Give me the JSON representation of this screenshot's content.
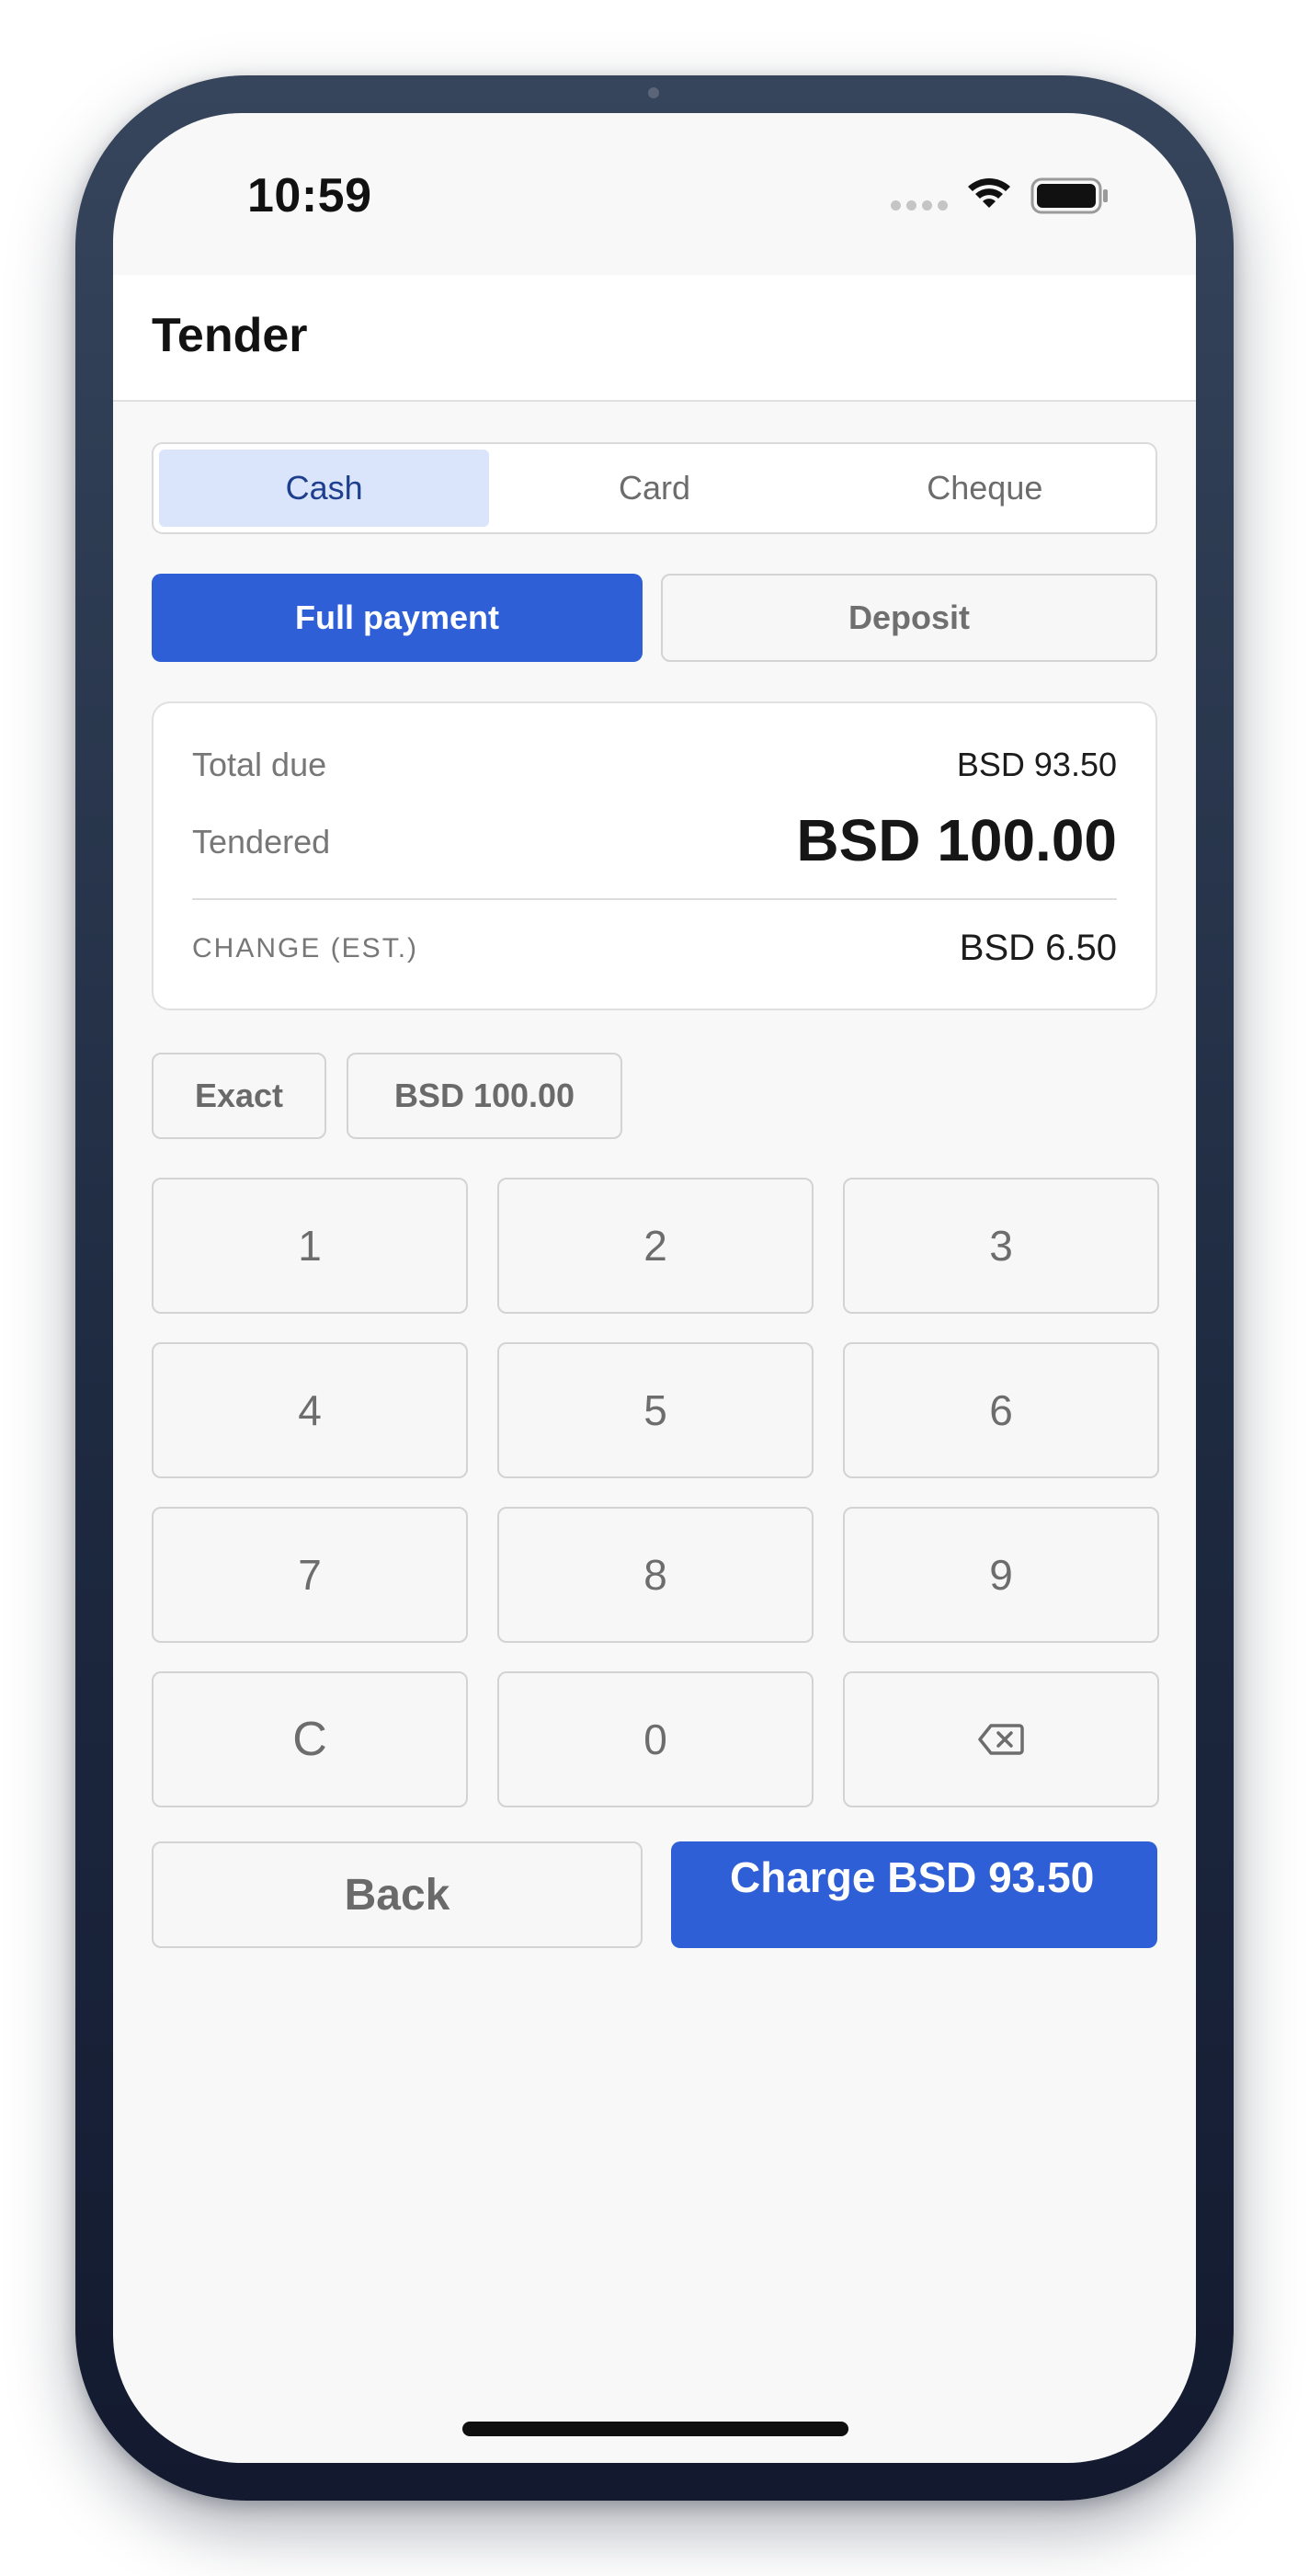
{
  "status_bar": {
    "time": "10:59"
  },
  "header": {
    "title": "Tender"
  },
  "tabs": [
    {
      "label": "Cash",
      "active": true
    },
    {
      "label": "Card",
      "active": false
    },
    {
      "label": "Cheque",
      "active": false
    }
  ],
  "payment_mode": {
    "full_label": "Full payment",
    "deposit_label": "Deposit",
    "selected": "full"
  },
  "summary": {
    "total_due_label": "Total due",
    "total_due_value": "BSD 93.50",
    "tendered_label": "Tendered",
    "tendered_value": "BSD 100.00",
    "change_label": "CHANGE (EST.)",
    "change_value": "BSD 6.50"
  },
  "quick_amounts": [
    "Exact",
    "BSD 100.00"
  ],
  "keypad": {
    "keys": [
      "1",
      "2",
      "3",
      "4",
      "5",
      "6",
      "7",
      "8",
      "9",
      "C",
      "0"
    ],
    "backspace_icon": "backspace-icon"
  },
  "actions": {
    "back_label": "Back",
    "charge_label": "Charge BSD 93.50"
  },
  "colors": {
    "primary": "#2e5fd6",
    "tab_active_bg": "#dae5fb",
    "tab_active_text": "#1e3f8e",
    "phone_frame": "#1e2a40"
  }
}
